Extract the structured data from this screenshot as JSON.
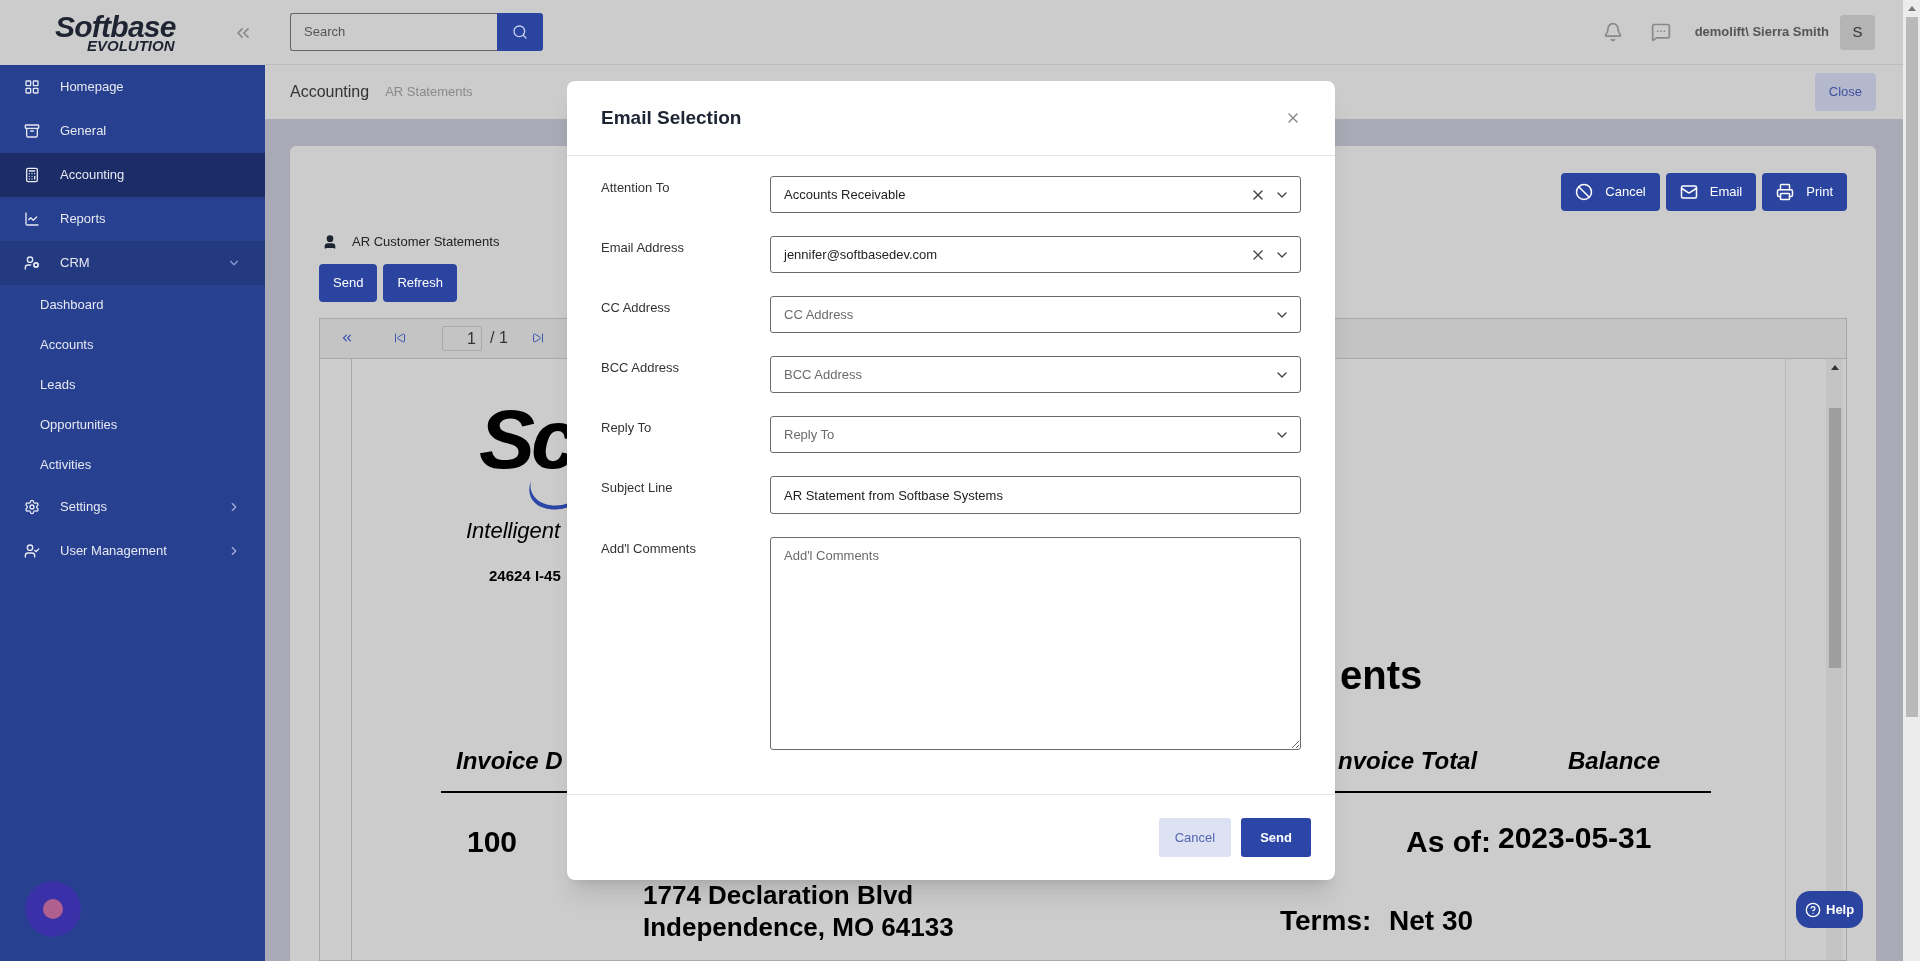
{
  "sidebar": {
    "logo": {
      "word": "Softbase",
      "sub": "EVOLUTION"
    },
    "items": [
      {
        "label": "Homepage",
        "kind": "link",
        "selected": false
      },
      {
        "label": "General",
        "kind": "link",
        "selected": false
      },
      {
        "label": "Accounting",
        "kind": "link",
        "selected": true
      },
      {
        "label": "Reports",
        "kind": "link",
        "selected": false
      },
      {
        "label": "CRM",
        "kind": "group",
        "selected": false,
        "expanded": true,
        "children": [
          {
            "label": "Dashboard"
          },
          {
            "label": "Accounts"
          },
          {
            "label": "Leads"
          },
          {
            "label": "Opportunities"
          },
          {
            "label": "Activities"
          }
        ]
      },
      {
        "label": "Settings",
        "kind": "group",
        "selected": false,
        "expanded": false
      },
      {
        "label": "User Management",
        "kind": "group",
        "selected": false,
        "expanded": false
      }
    ]
  },
  "header": {
    "search": {
      "placeholder": "Search"
    },
    "user": "demolift\\ Sierra Smith",
    "avatar": "S"
  },
  "breadcrumb": [
    "Accounting",
    "AR Statements"
  ],
  "close_button": "Close",
  "actions": [
    "Cancel",
    "Email",
    "Print"
  ],
  "report": {
    "title": "AR Customer Statements",
    "buttons": [
      "Send",
      "Refresh"
    ],
    "page": "1",
    "page_total": "/ 1"
  },
  "document": {
    "logo_text": "Sc",
    "tagline": "Intelligent",
    "address": "24624 I-45",
    "heading": "ents",
    "columns": [
      "Invoice D",
      "nvoice Total",
      "Balance"
    ],
    "number": "100",
    "as_of_label": "As of:",
    "as_of": "2023-05-31",
    "street": "1774 Declaration Blvd",
    "city": "Independence, MO 64133",
    "terms_label": "Terms:",
    "terms": "Net 30"
  },
  "modal": {
    "title": "Email Selection",
    "fields": [
      {
        "label": "Attention To",
        "kind": "select",
        "value": "Accounts Receivable",
        "clearable": true
      },
      {
        "label": "Email Address",
        "kind": "select",
        "value": "jennifer@softbasedev.com",
        "clearable": true
      },
      {
        "label": "CC Address",
        "kind": "select",
        "placeholder": "CC Address",
        "clearable": false
      },
      {
        "label": "BCC Address",
        "kind": "select",
        "placeholder": "BCC Address",
        "clearable": false
      },
      {
        "label": "Reply To",
        "kind": "select",
        "placeholder": "Reply To",
        "clearable": false
      },
      {
        "label": "Subject Line",
        "kind": "input",
        "value": "AR Statement from Softbase Systems"
      },
      {
        "label": "Add'l Comments",
        "kind": "textarea",
        "placeholder": "Add'l Comments"
      }
    ],
    "buttons": [
      {
        "label": "Cancel",
        "kind": "secondary"
      },
      {
        "label": "Send",
        "kind": "primary"
      }
    ]
  },
  "help": "Help"
}
